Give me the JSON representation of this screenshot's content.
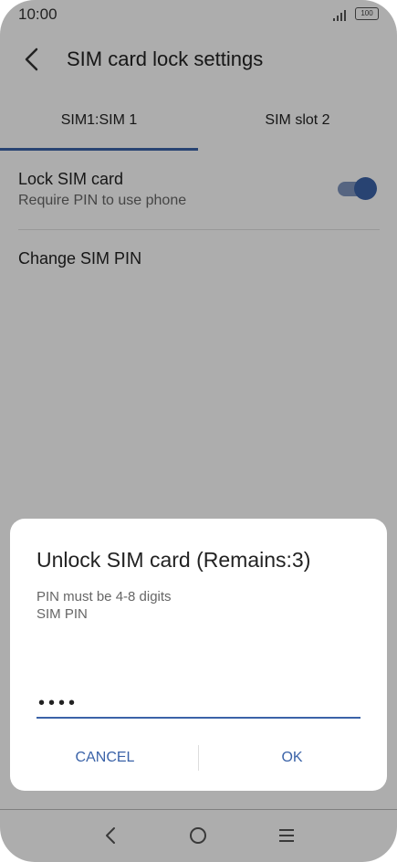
{
  "status_bar": {
    "time": "10:00",
    "battery": "100"
  },
  "app_bar": {
    "title": "SIM card lock settings"
  },
  "tabs": [
    {
      "label": "SIM1:SIM 1",
      "selected": true
    },
    {
      "label": "SIM slot 2",
      "selected": false
    }
  ],
  "settings": {
    "lock_sim": {
      "title": "Lock SIM card",
      "subtitle": "Require PIN to use phone",
      "enabled": true
    },
    "change_pin": {
      "title": "Change SIM PIN"
    }
  },
  "dialog": {
    "title": "Unlock SIM card (Remains:3)",
    "hint": "PIN must be 4-8 digits",
    "field_label": "SIM PIN",
    "pin_value": "••••",
    "cancel_label": "CANCEL",
    "ok_label": "OK"
  },
  "colors": {
    "accent": "#3b63a8"
  }
}
